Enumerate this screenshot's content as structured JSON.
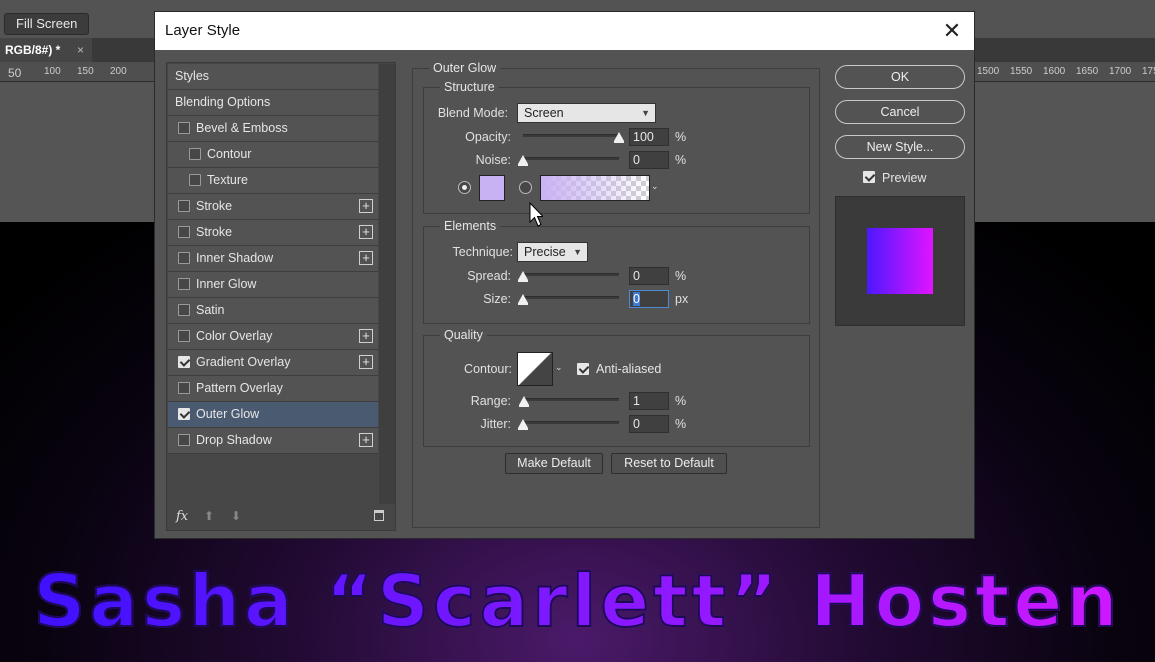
{
  "app": {
    "fill_screen_label": "Fill Screen",
    "doc_tab_label": "RGB/8#) *",
    "doc_tab_close": "×",
    "ruler_left": [
      "50",
      "100",
      "150",
      "200"
    ],
    "ruler_right": [
      "1500",
      "1550",
      "1600",
      "1650",
      "1700",
      "175"
    ]
  },
  "banner": {
    "text": "Sasha “Scarlett” Hosten"
  },
  "dialog": {
    "title": "Layer Style",
    "close_glyph": "✕",
    "styles_list": [
      {
        "label": "Styles",
        "checkbox": false,
        "checked": false,
        "plus": false,
        "indent": 0,
        "selected": false
      },
      {
        "label": "Blending Options",
        "checkbox": false,
        "checked": false,
        "plus": false,
        "indent": 0,
        "selected": false
      },
      {
        "label": "Bevel & Emboss",
        "checkbox": true,
        "checked": false,
        "plus": false,
        "indent": 0,
        "selected": false
      },
      {
        "label": "Contour",
        "checkbox": true,
        "checked": false,
        "plus": false,
        "indent": 1,
        "selected": false
      },
      {
        "label": "Texture",
        "checkbox": true,
        "checked": false,
        "plus": false,
        "indent": 1,
        "selected": false
      },
      {
        "label": "Stroke",
        "checkbox": true,
        "checked": false,
        "plus": true,
        "indent": 0,
        "selected": false
      },
      {
        "label": "Stroke",
        "checkbox": true,
        "checked": false,
        "plus": true,
        "indent": 0,
        "selected": false
      },
      {
        "label": "Inner Shadow",
        "checkbox": true,
        "checked": false,
        "plus": true,
        "indent": 0,
        "selected": false
      },
      {
        "label": "Inner Glow",
        "checkbox": true,
        "checked": false,
        "plus": false,
        "indent": 0,
        "selected": false
      },
      {
        "label": "Satin",
        "checkbox": true,
        "checked": false,
        "plus": false,
        "indent": 0,
        "selected": false
      },
      {
        "label": "Color Overlay",
        "checkbox": true,
        "checked": false,
        "plus": true,
        "indent": 0,
        "selected": false
      },
      {
        "label": "Gradient Overlay",
        "checkbox": true,
        "checked": true,
        "plus": true,
        "indent": 0,
        "selected": false
      },
      {
        "label": "Pattern Overlay",
        "checkbox": true,
        "checked": false,
        "plus": false,
        "indent": 0,
        "selected": false
      },
      {
        "label": "Outer Glow",
        "checkbox": true,
        "checked": true,
        "plus": false,
        "indent": 0,
        "selected": true
      },
      {
        "label": "Drop Shadow",
        "checkbox": true,
        "checked": false,
        "plus": true,
        "indent": 0,
        "selected": false
      }
    ],
    "footer": {
      "fx_label": "fx",
      "up_glyph": "⬆",
      "down_glyph": "⬇"
    },
    "outer_glow": {
      "section_title": "Outer Glow",
      "structure": {
        "title": "Structure",
        "blend_mode_label": "Blend Mode:",
        "blend_mode_value": "Screen",
        "opacity_label": "Opacity:",
        "opacity_value": "100",
        "opacity_level": 1.0,
        "opacity_unit": "%",
        "noise_label": "Noise:",
        "noise_value": "0",
        "noise_level": 0,
        "noise_unit": "%",
        "glow_color": "#c9b2f4"
      },
      "elements": {
        "title": "Elements",
        "technique_label": "Technique:",
        "technique_value": "Precise",
        "spread_label": "Spread:",
        "spread_value": "0",
        "spread_level": 0,
        "spread_unit": "%",
        "size_label": "Size:",
        "size_value": "0",
        "size_level": 0,
        "size_unit": "px"
      },
      "quality": {
        "title": "Quality",
        "contour_label": "Contour:",
        "anti_aliased_label": "Anti-aliased",
        "anti_aliased_checked": true,
        "range_label": "Range:",
        "range_value": "1",
        "range_level": 0.01,
        "range_unit": "%",
        "jitter_label": "Jitter:",
        "jitter_value": "0",
        "jitter_level": 0,
        "jitter_unit": "%"
      },
      "make_default_label": "Make Default",
      "reset_default_label": "Reset to Default"
    },
    "buttons": {
      "ok": "OK",
      "cancel": "Cancel",
      "new_style": "New Style...",
      "preview_label": "Preview",
      "preview_checked": true
    }
  }
}
